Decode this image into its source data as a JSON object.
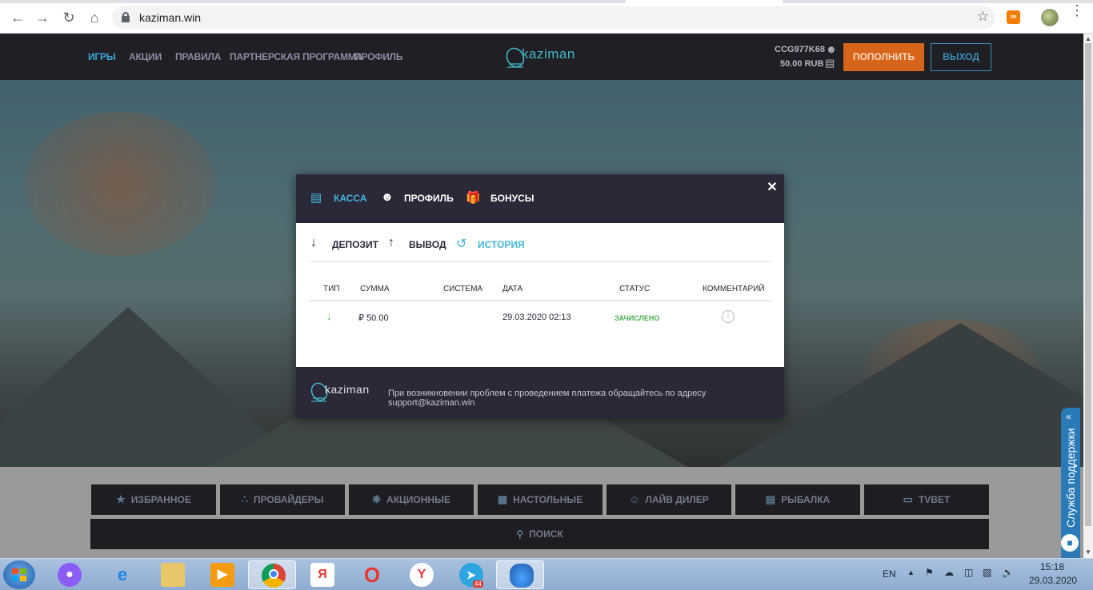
{
  "browser": {
    "url": "kaziman.win",
    "back_icon": "arrow-left-icon",
    "forward_icon": "arrow-right-icon",
    "reload_icon": "reload-icon",
    "home_icon": "home-icon"
  },
  "site": {
    "nav": [
      "ИГРЫ",
      "АКЦИИ",
      "ПРАВИЛА",
      "ПАРТНЕРСКАЯ ПРОГРАММА",
      "ПРОФИЛЬ"
    ],
    "logo_text": "kaziman",
    "user_id": "CCG977K68",
    "balance": "50.00 RUB",
    "deposit_button": "ПОПОЛНИТЬ",
    "exit_button": "ВЫХОД",
    "accent_color": "#3ea6d8",
    "deposit_color": "#d6651a"
  },
  "modal": {
    "tabs": [
      "КАССА",
      "ПРОФИЛЬ",
      "БОНУСЫ"
    ],
    "active_tab": "КАССА",
    "subtabs": [
      "ДЕПОЗИТ",
      "ВЫВОД",
      "ИСТОРИЯ"
    ],
    "active_subtab": "ИСТОРИЯ",
    "table": {
      "headers": [
        "ТИП",
        "СУММА",
        "СИСТЕМА",
        "ДАТА",
        "СТАТУС",
        "КОММЕНТАРИЙ"
      ],
      "rows": [
        {
          "type_icon": "arrow-down-icon",
          "amount": "₽ 50.00",
          "system": "",
          "date": "29.03.2020 02:13",
          "status": "ЗАЧИСЛЕНО",
          "comment_icon": "info-icon"
        }
      ]
    },
    "footer_logo": "kaziman",
    "footer_text": "При возникновении проблем с проведением платежа обращайтесь по адресу support@kaziman.win"
  },
  "categories": [
    "ИЗБРАННОЕ",
    "ПРОВАЙДЕРЫ",
    "АКЦИОННЫЕ",
    "НАСТОЛЬНЫЕ",
    "ЛАЙВ ДИЛЕР",
    "РЫБАЛКА",
    "TVBET"
  ],
  "search_label": "ПОИСК",
  "support_label": "Служба поддержки",
  "taskbar": {
    "lang": "EN",
    "time": "15:18",
    "date": "29.03.2020",
    "telegram_badge": "44"
  }
}
